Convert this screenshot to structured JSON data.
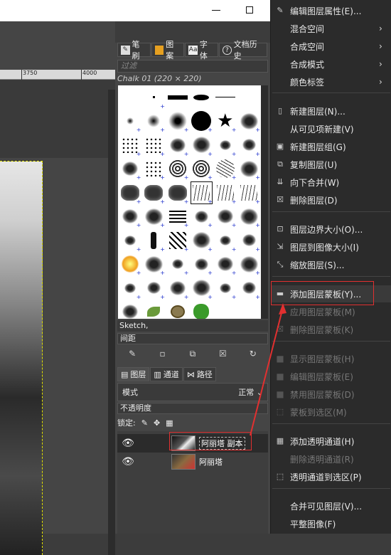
{
  "ruler": {
    "marks": [
      "3750",
      "4000"
    ]
  },
  "brushes_panel": {
    "tabs": [
      {
        "label": "笔刷",
        "icon": "brush-icon"
      },
      {
        "label": "图案",
        "icon": "pattern-icon"
      },
      {
        "label": "字体",
        "icon": "font-icon"
      },
      {
        "label": "文档历史",
        "icon": "history-icon"
      }
    ],
    "filter_placeholder": "过滤",
    "current_brush": "Chalk 01 (220 × 220)",
    "selected_name": "Sketch,",
    "spacing_label": "间距"
  },
  "layers_panel": {
    "tabs": [
      {
        "label": "图层",
        "icon": "layers-icon"
      },
      {
        "label": "通道",
        "icon": "channels-icon"
      },
      {
        "label": "路径",
        "icon": "paths-icon"
      }
    ],
    "mode_label": "模式",
    "mode_value": "正常",
    "opacity_label": "不透明度",
    "lock_label": "锁定:",
    "layers": [
      {
        "name": "阿丽塔 副本",
        "selected": true
      },
      {
        "name": "阿丽塔",
        "selected": false
      }
    ]
  },
  "menu": {
    "items": [
      {
        "label": "编辑图层属性(E)...",
        "icon": "edit-icon",
        "submenu": false,
        "disabled": false
      },
      {
        "label": "混合空间",
        "icon": "",
        "submenu": true,
        "disabled": false
      },
      {
        "label": "合成空间",
        "icon": "",
        "submenu": true,
        "disabled": false
      },
      {
        "label": "合成模式",
        "icon": "",
        "submenu": true,
        "disabled": false
      },
      {
        "label": "颜色标签",
        "icon": "",
        "submenu": true,
        "disabled": false
      },
      {
        "label": "新建图层(N)...",
        "icon": "new-layer-icon",
        "submenu": false,
        "disabled": false
      },
      {
        "label": "从可见项新建(V)",
        "icon": "",
        "submenu": false,
        "disabled": false
      },
      {
        "label": "新建图层组(G)",
        "icon": "new-group-icon",
        "submenu": false,
        "disabled": false
      },
      {
        "label": "复制图层(U)",
        "icon": "duplicate-icon",
        "submenu": false,
        "disabled": false
      },
      {
        "label": "向下合并(W)",
        "icon": "merge-down-icon",
        "submenu": false,
        "disabled": false
      },
      {
        "label": "删除图层(D)",
        "icon": "delete-icon",
        "submenu": false,
        "disabled": false
      },
      {
        "label": "图层边界大小(O)...",
        "icon": "boundary-icon",
        "submenu": false,
        "disabled": false
      },
      {
        "label": "图层到图像大小(I)",
        "icon": "to-image-size-icon",
        "submenu": false,
        "disabled": false
      },
      {
        "label": "缩放图层(S)...",
        "icon": "scale-icon",
        "submenu": false,
        "disabled": false
      },
      {
        "label": "添加图层蒙板(Y)...",
        "icon": "add-mask-icon",
        "submenu": false,
        "disabled": false
      },
      {
        "label": "应用图层蒙板(M)",
        "icon": "",
        "submenu": false,
        "disabled": true
      },
      {
        "label": "删除图层蒙板(K)",
        "icon": "delete-mask-icon",
        "submenu": false,
        "disabled": true
      },
      {
        "label": "显示图层蒙板(H)",
        "icon": "checkbox-icon",
        "submenu": false,
        "disabled": true
      },
      {
        "label": "编辑图层蒙板(E)",
        "icon": "checkbox-icon",
        "submenu": false,
        "disabled": true
      },
      {
        "label": "禁用图层蒙板(D)",
        "icon": "checkbox-icon",
        "submenu": false,
        "disabled": true
      },
      {
        "label": "蒙板到选区(M)",
        "icon": "mask-to-selection-icon",
        "submenu": false,
        "disabled": true
      },
      {
        "label": "添加透明通道(H)",
        "icon": "alpha-icon",
        "submenu": false,
        "disabled": false
      },
      {
        "label": "删除透明通道(R)",
        "icon": "",
        "submenu": false,
        "disabled": true
      },
      {
        "label": "透明通道到选区(P)",
        "icon": "alpha-to-selection-icon",
        "submenu": false,
        "disabled": false
      },
      {
        "label": "合并可见图层(V)...",
        "icon": "",
        "submenu": false,
        "disabled": false
      },
      {
        "label": "平整图像(F)",
        "icon": "",
        "submenu": false,
        "disabled": false
      }
    ]
  },
  "colors": {
    "highlight": "#e23030",
    "menu_bg": "#2b2b2b",
    "panel_bg": "#454545"
  }
}
